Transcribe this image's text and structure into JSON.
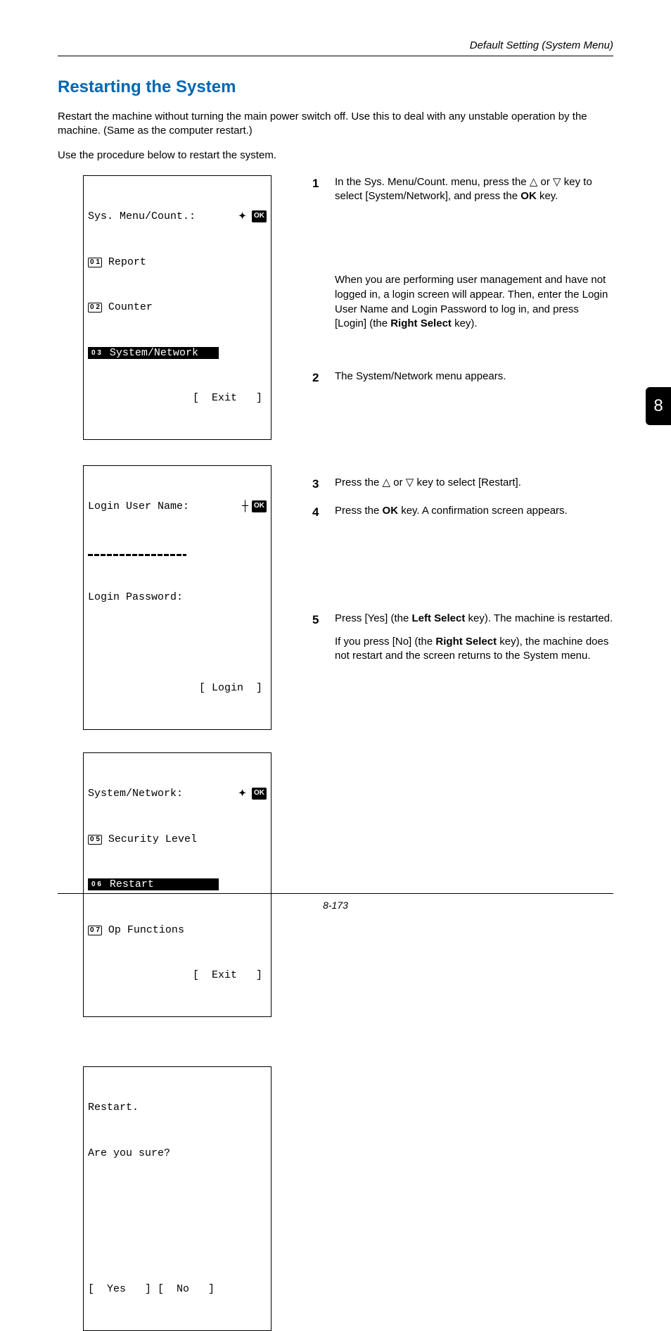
{
  "running_head": "Default Setting (System Menu)",
  "h1": "Restarting the System",
  "intro1": "Restart the machine without turning the main power switch off. Use this to deal with any unstable operation by the machine. (Same as the computer restart.)",
  "intro2": "Use the procedure below to restart the system.",
  "lcd1": {
    "title_left": "Sys. Menu/Count.:",
    "item1_num": "0 1",
    "item1": "Report",
    "item2_num": "0 2",
    "item2": "Counter",
    "item3_num": "0 3",
    "item3": "System/Network",
    "soft": "[  Exit   ]"
  },
  "lcd2": {
    "l1_left": "Login User Name:",
    "l2": "Login Password:",
    "soft": "[ Login  ]"
  },
  "lcd3": {
    "title_left": "System/Network:",
    "item1_num": "0 5",
    "item1": "Security Level",
    "item2_num": "0 6",
    "item2": "Restart",
    "item3_num": "0 7",
    "item3": "Op Functions",
    "soft": "[  Exit   ]"
  },
  "lcd4": {
    "l1": "Restart.",
    "l2": "Are you sure?",
    "soft": "[  Yes   ] [  No   ]"
  },
  "steps": {
    "s1a": "In the Sys. Menu/Count. menu, press the ",
    "s1b": " or ",
    "s1c": " key to select [System/Network], and press the ",
    "s1d": "OK",
    "s1e": " key.",
    "s1f1": "When you are performing user management and have not logged in, a login screen will appear. Then, enter the Login User Name and Login Password to log in, and press [Login] (the ",
    "s1f2": "Right Select",
    "s1f3": " key).",
    "s2": "The System/Network menu appears.",
    "s3a": "Press the ",
    "s3b": " or ",
    "s3c": " key to select [Restart].",
    "s4a": "Press the ",
    "s4b": "OK",
    "s4c": " key. A confirmation screen appears.",
    "s5a": "Press [Yes] (the ",
    "s5b": "Left Select",
    "s5c": " key). The machine is restarted.",
    "s5d": "If you press [No] (the ",
    "s5e": "Right Select",
    "s5f": " key), the machine does not restart and the screen returns to the System menu."
  },
  "tab": "8",
  "page_num": "8-173",
  "ok_label": "OK"
}
